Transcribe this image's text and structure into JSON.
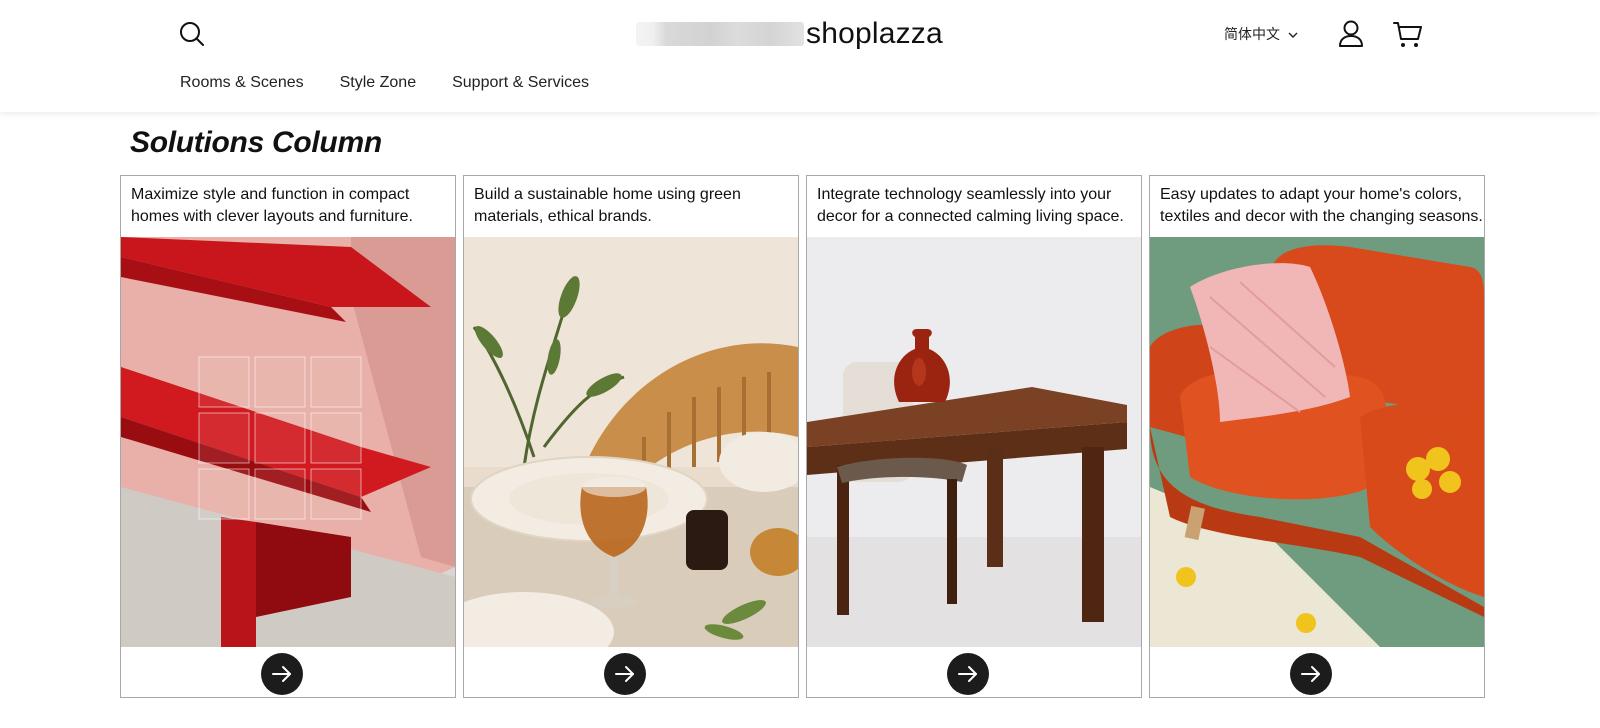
{
  "header": {
    "logo_text": "shoplazza",
    "language": "简体中文",
    "nav": [
      "Rooms & Scenes",
      "Style Zone",
      "Support & Services"
    ]
  },
  "section": {
    "title": "Solutions Column",
    "cards": [
      {
        "text": "Maximize style and function in compact homes with clever layouts and furniture.",
        "image": "red-shelf-image"
      },
      {
        "text": "Build a sustainable home using green materials, ethical brands.",
        "image": "dining-table-image"
      },
      {
        "text": "Integrate technology seamlessly into your decor for a connected calming living space.",
        "image": "wood-table-vase-image"
      },
      {
        "text": "Easy updates to adapt your home's colors, textiles and decor with the changing seasons.",
        "image": "orange-sofa-image"
      }
    ]
  },
  "icons": {
    "search": "search-icon",
    "account": "user-icon",
    "cart": "cart-icon",
    "chevron": "chevron-down-icon",
    "card_button": "arrow-right-icon"
  },
  "colors": {
    "button_bg": "#1c1c1c",
    "card_border": "#a8a8a8"
  }
}
